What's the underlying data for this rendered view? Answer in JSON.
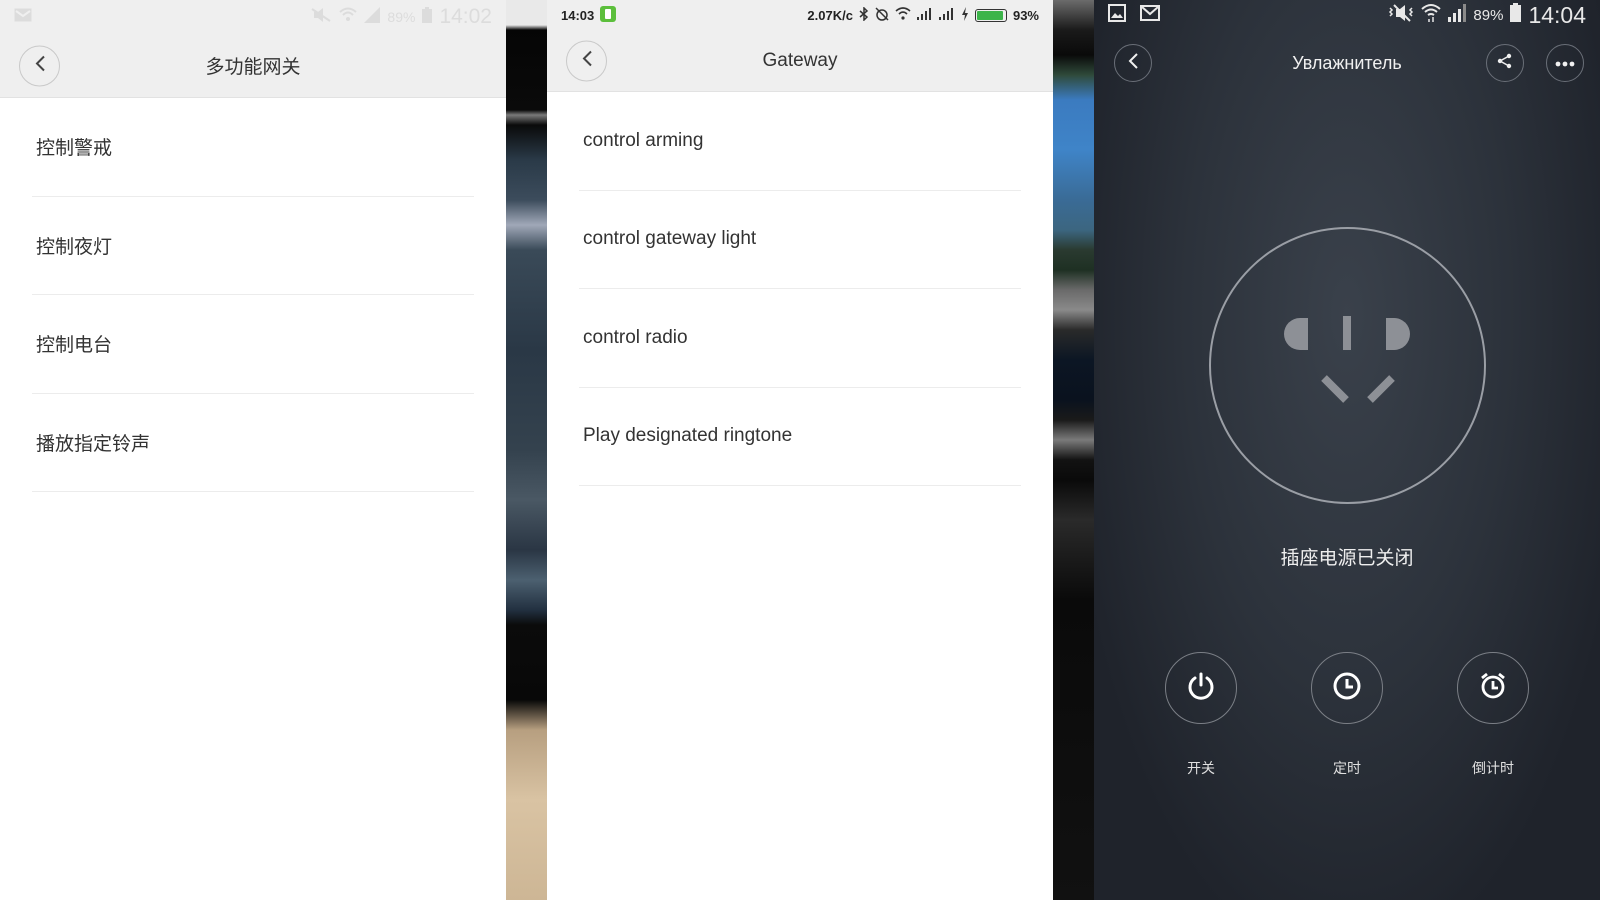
{
  "panel_left": {
    "status": {
      "battery": "89%",
      "time": "14:02"
    },
    "header": {
      "title": "多功能网关"
    },
    "items": [
      {
        "label": "控制警戒"
      },
      {
        "label": "控制夜灯"
      },
      {
        "label": "控制电台"
      },
      {
        "label": "播放指定铃声"
      }
    ]
  },
  "panel_middle": {
    "status": {
      "time": "14:03",
      "speed": "2.07K/c",
      "battery": "93%",
      "battery_level": 0.93
    },
    "header": {
      "title": "Gateway"
    },
    "items": [
      {
        "label": "control arming"
      },
      {
        "label": "control gateway light"
      },
      {
        "label": "control radio"
      },
      {
        "label": "Play designated ringtone"
      }
    ]
  },
  "panel_right": {
    "status": {
      "battery": "89%",
      "time": "14:04"
    },
    "header": {
      "title": "Увлажнитель"
    },
    "socket_status": "插座电源已关闭",
    "controls": [
      {
        "label": "开关",
        "icon": "power-icon"
      },
      {
        "label": "定时",
        "icon": "clock-icon"
      },
      {
        "label": "倒计时",
        "icon": "alarm-clock-icon"
      }
    ]
  },
  "colors": {
    "accent_green": "#3cb44a",
    "dark_bg": "#262b33",
    "light_header": "#efefef"
  }
}
